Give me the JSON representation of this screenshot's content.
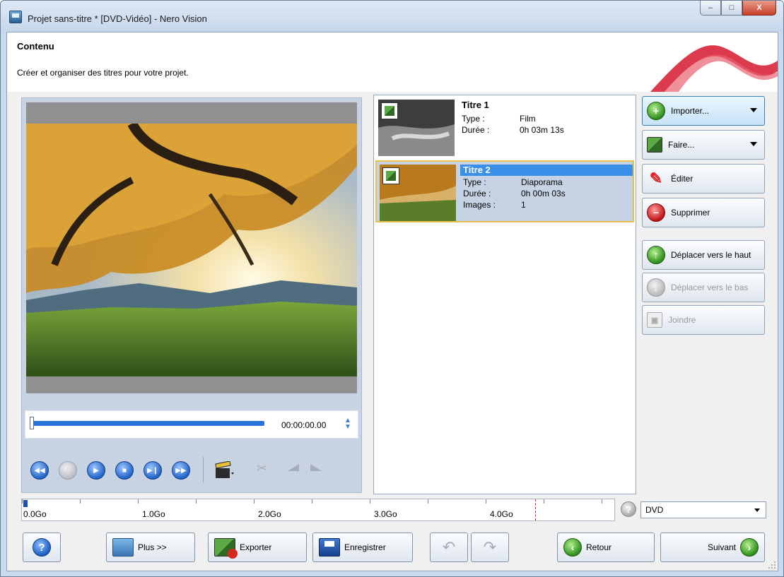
{
  "window": {
    "title": "Projet sans-titre * [DVD-Vidéo] - Nero Vision",
    "minimize_glyph": "–",
    "maximize_glyph": "□",
    "close_glyph": "X"
  },
  "header": {
    "title": "Contenu",
    "subtitle": "Créer et organiser des titres pour votre projet."
  },
  "preview": {
    "time": "00:00:00.00",
    "position_fraction": 0.0
  },
  "titles": [
    {
      "name": "Titre 1",
      "type_label": "Type :",
      "type": "Film",
      "duration_label": "Durée :",
      "duration": "0h 03m 13s"
    },
    {
      "name": "Titre 2",
      "type_label": "Type :",
      "type": "Diaporama",
      "duration_label": "Durée :",
      "duration": "0h 00m 03s",
      "images_label": "Images :",
      "images": "1"
    }
  ],
  "actions": {
    "import": "Importer...",
    "make": "Faire...",
    "edit": "Éditer",
    "delete": "Supprimer",
    "move_up": "Déplacer vers le haut",
    "move_down": "Déplacer vers le bas",
    "join": "Joindre"
  },
  "capacity": {
    "labels": [
      "0.0Go",
      "1.0Go",
      "2.0Go",
      "3.0Go",
      "4.0Go"
    ],
    "disc": "DVD"
  },
  "bottom": {
    "more": "Plus >>",
    "export": "Exporter",
    "save": "Enregistrer",
    "back": "Retour",
    "next": "Suivant",
    "help_glyph": "?"
  },
  "colors": {
    "accent": "#3a8fe8",
    "selection_border": "#e8c14b",
    "capacity_limit": "#dd1111"
  }
}
